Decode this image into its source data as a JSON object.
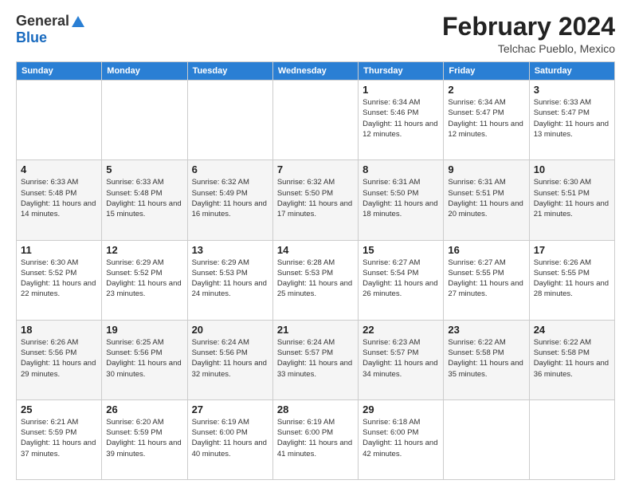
{
  "logo": {
    "text_general": "General",
    "text_blue": "Blue"
  },
  "header": {
    "title": "February 2024",
    "subtitle": "Telchac Pueblo, Mexico"
  },
  "days_of_week": [
    "Sunday",
    "Monday",
    "Tuesday",
    "Wednesday",
    "Thursday",
    "Friday",
    "Saturday"
  ],
  "weeks": [
    [
      {
        "day": "",
        "info": ""
      },
      {
        "day": "",
        "info": ""
      },
      {
        "day": "",
        "info": ""
      },
      {
        "day": "",
        "info": ""
      },
      {
        "day": "1",
        "info": "Sunrise: 6:34 AM\nSunset: 5:46 PM\nDaylight: 11 hours and 12 minutes."
      },
      {
        "day": "2",
        "info": "Sunrise: 6:34 AM\nSunset: 5:47 PM\nDaylight: 11 hours and 12 minutes."
      },
      {
        "day": "3",
        "info": "Sunrise: 6:33 AM\nSunset: 5:47 PM\nDaylight: 11 hours and 13 minutes."
      }
    ],
    [
      {
        "day": "4",
        "info": "Sunrise: 6:33 AM\nSunset: 5:48 PM\nDaylight: 11 hours and 14 minutes."
      },
      {
        "day": "5",
        "info": "Sunrise: 6:33 AM\nSunset: 5:48 PM\nDaylight: 11 hours and 15 minutes."
      },
      {
        "day": "6",
        "info": "Sunrise: 6:32 AM\nSunset: 5:49 PM\nDaylight: 11 hours and 16 minutes."
      },
      {
        "day": "7",
        "info": "Sunrise: 6:32 AM\nSunset: 5:50 PM\nDaylight: 11 hours and 17 minutes."
      },
      {
        "day": "8",
        "info": "Sunrise: 6:31 AM\nSunset: 5:50 PM\nDaylight: 11 hours and 18 minutes."
      },
      {
        "day": "9",
        "info": "Sunrise: 6:31 AM\nSunset: 5:51 PM\nDaylight: 11 hours and 20 minutes."
      },
      {
        "day": "10",
        "info": "Sunrise: 6:30 AM\nSunset: 5:51 PM\nDaylight: 11 hours and 21 minutes."
      }
    ],
    [
      {
        "day": "11",
        "info": "Sunrise: 6:30 AM\nSunset: 5:52 PM\nDaylight: 11 hours and 22 minutes."
      },
      {
        "day": "12",
        "info": "Sunrise: 6:29 AM\nSunset: 5:52 PM\nDaylight: 11 hours and 23 minutes."
      },
      {
        "day": "13",
        "info": "Sunrise: 6:29 AM\nSunset: 5:53 PM\nDaylight: 11 hours and 24 minutes."
      },
      {
        "day": "14",
        "info": "Sunrise: 6:28 AM\nSunset: 5:53 PM\nDaylight: 11 hours and 25 minutes."
      },
      {
        "day": "15",
        "info": "Sunrise: 6:27 AM\nSunset: 5:54 PM\nDaylight: 11 hours and 26 minutes."
      },
      {
        "day": "16",
        "info": "Sunrise: 6:27 AM\nSunset: 5:55 PM\nDaylight: 11 hours and 27 minutes."
      },
      {
        "day": "17",
        "info": "Sunrise: 6:26 AM\nSunset: 5:55 PM\nDaylight: 11 hours and 28 minutes."
      }
    ],
    [
      {
        "day": "18",
        "info": "Sunrise: 6:26 AM\nSunset: 5:56 PM\nDaylight: 11 hours and 29 minutes."
      },
      {
        "day": "19",
        "info": "Sunrise: 6:25 AM\nSunset: 5:56 PM\nDaylight: 11 hours and 30 minutes."
      },
      {
        "day": "20",
        "info": "Sunrise: 6:24 AM\nSunset: 5:56 PM\nDaylight: 11 hours and 32 minutes."
      },
      {
        "day": "21",
        "info": "Sunrise: 6:24 AM\nSunset: 5:57 PM\nDaylight: 11 hours and 33 minutes."
      },
      {
        "day": "22",
        "info": "Sunrise: 6:23 AM\nSunset: 5:57 PM\nDaylight: 11 hours and 34 minutes."
      },
      {
        "day": "23",
        "info": "Sunrise: 6:22 AM\nSunset: 5:58 PM\nDaylight: 11 hours and 35 minutes."
      },
      {
        "day": "24",
        "info": "Sunrise: 6:22 AM\nSunset: 5:58 PM\nDaylight: 11 hours and 36 minutes."
      }
    ],
    [
      {
        "day": "25",
        "info": "Sunrise: 6:21 AM\nSunset: 5:59 PM\nDaylight: 11 hours and 37 minutes."
      },
      {
        "day": "26",
        "info": "Sunrise: 6:20 AM\nSunset: 5:59 PM\nDaylight: 11 hours and 39 minutes."
      },
      {
        "day": "27",
        "info": "Sunrise: 6:19 AM\nSunset: 6:00 PM\nDaylight: 11 hours and 40 minutes."
      },
      {
        "day": "28",
        "info": "Sunrise: 6:19 AM\nSunset: 6:00 PM\nDaylight: 11 hours and 41 minutes."
      },
      {
        "day": "29",
        "info": "Sunrise: 6:18 AM\nSunset: 6:00 PM\nDaylight: 11 hours and 42 minutes."
      },
      {
        "day": "",
        "info": ""
      },
      {
        "day": "",
        "info": ""
      }
    ]
  ]
}
